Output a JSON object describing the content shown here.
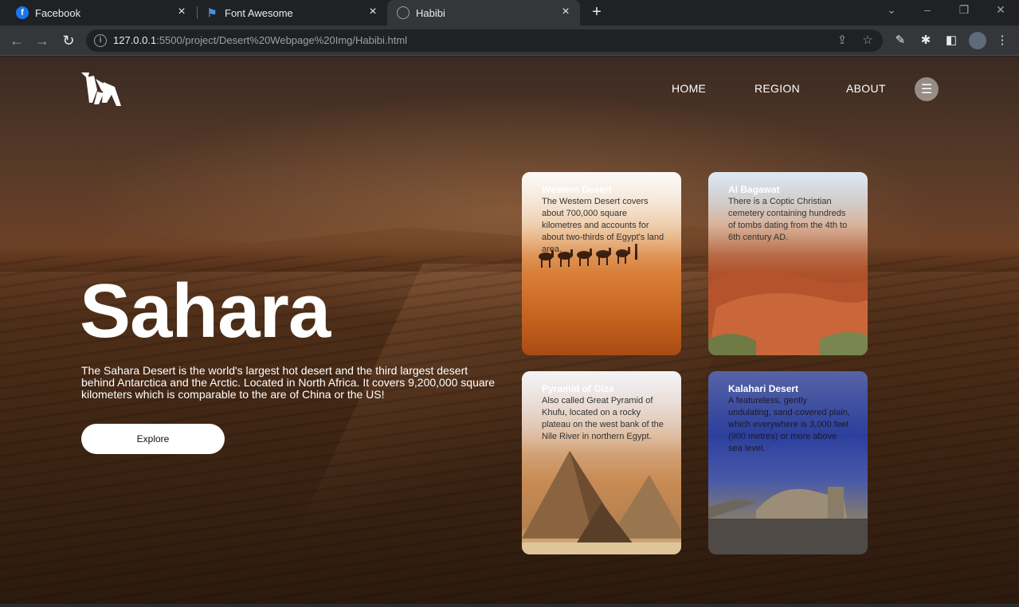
{
  "browser": {
    "tabs": [
      {
        "title": "Facebook",
        "icon": "facebook-icon"
      },
      {
        "title": "Font Awesome",
        "icon": "flag-icon"
      },
      {
        "title": "Habibi",
        "icon": "globe-icon",
        "active": true
      }
    ],
    "url_host": "127.0.0.1",
    "url_rest": ":5500/project/Desert%20Webpage%20Img/Habibi.html"
  },
  "nav": {
    "links": [
      "HOME",
      "REGION",
      "ABOUT"
    ]
  },
  "hero": {
    "title": "Sahara",
    "description": "The Sahara Desert is the world's largest hot desert and the third largest desert behind Antarctica and the Arctic. Located in North Africa. It covers 9,200,000 square kilometers which is comparable to the are of China or the US!",
    "button": "Explore"
  },
  "cards": [
    {
      "title": "Western Desert",
      "text": "The Western Desert covers about 700,000 square kilometres and accounts for about two-thirds of Egypt's land area."
    },
    {
      "title": "Al Bagawat",
      "text": "There is a Coptic Christian cemetery containing hundreds of tombs dating from the 4th to 6th century AD."
    },
    {
      "title": "Pyramid of Giza",
      "text": "Also called Great Pyramid of Khufu, located on a rocky plateau on the west bank of the Nile River in northern Egypt."
    },
    {
      "title": "Kalahari Desert",
      "text": "A featureless, gently undulating, sand-covered plain, which everywhere is 3,000 feet (900 metres) or more above sea level."
    }
  ]
}
